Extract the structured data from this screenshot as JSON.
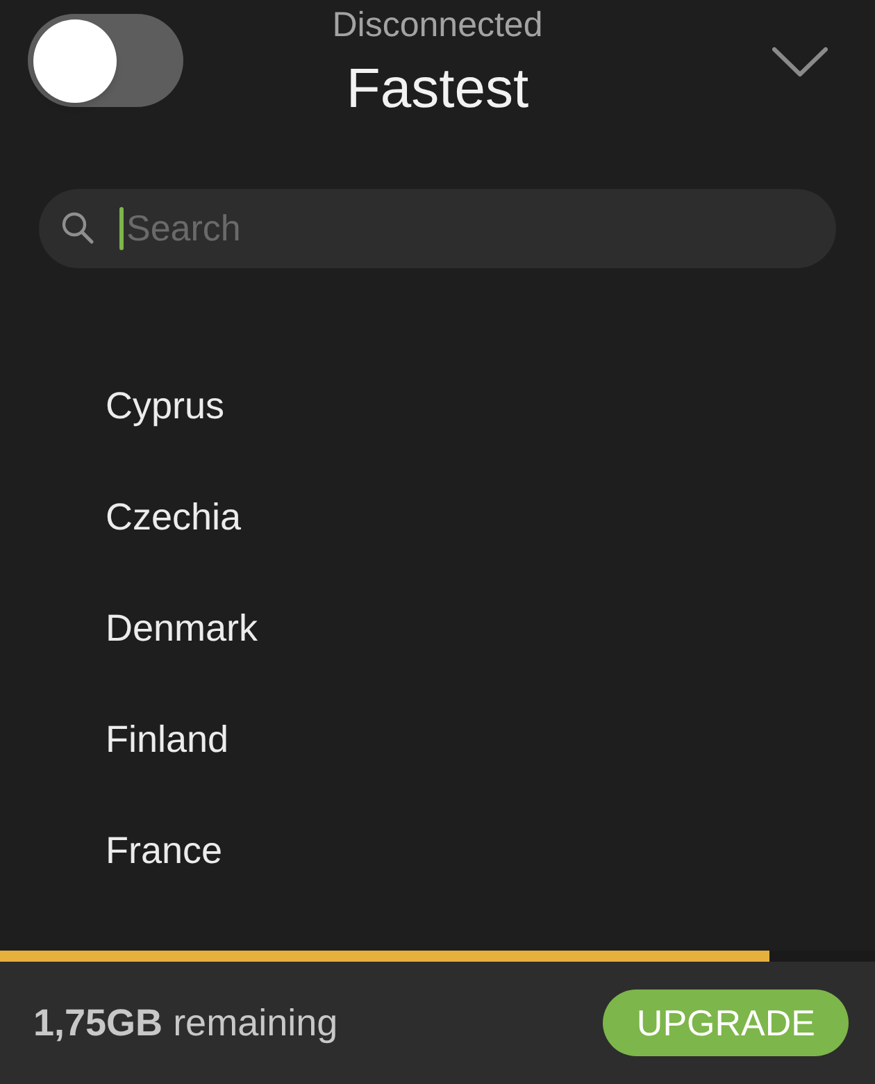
{
  "header": {
    "toggle": {
      "on": false
    },
    "status": "Disconnected",
    "location": "Fastest"
  },
  "search": {
    "placeholder": "Search"
  },
  "countries": [
    "Cyprus",
    "Czechia",
    "Denmark",
    "Finland",
    "France"
  ],
  "data_usage": {
    "level": 0.88
  },
  "footer": {
    "remaining": "**1,75GB** remaining",
    "button": "UPGRADE"
  }
}
